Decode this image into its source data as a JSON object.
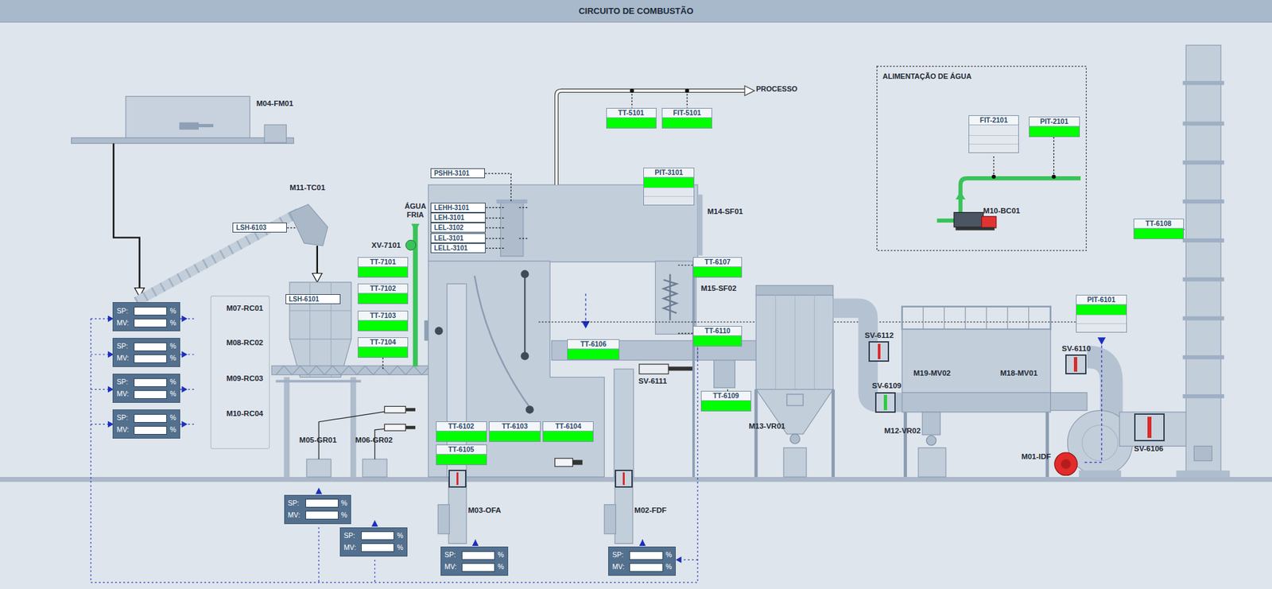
{
  "title": "CIRCUITO DE COMBUSTÃO",
  "equipment": [
    {
      "label": "M04-FM01"
    },
    {
      "label": "M11-TC01"
    },
    {
      "label": "M07-RC01"
    },
    {
      "label": "M08-RC02"
    },
    {
      "label": "M09-RC03"
    },
    {
      "label": "M10-RC04"
    },
    {
      "label": "M05-GR01"
    },
    {
      "label": "M06-GR02"
    },
    {
      "label": "M03-OFA"
    },
    {
      "label": "M02-FDF"
    },
    {
      "label": "M14-SF01"
    },
    {
      "label": "M15-SF02"
    },
    {
      "label": "M13-VR01"
    },
    {
      "label": "M19-MV02"
    },
    {
      "label": "M18-MV01"
    },
    {
      "label": "M12-VR02"
    },
    {
      "label": "M01-IDF"
    },
    {
      "label": "M10-BC01"
    },
    {
      "label": "SV-6111"
    }
  ],
  "notes": [
    {
      "text": "PROCESSO"
    },
    {
      "text": "ÁGUA FRIA"
    },
    {
      "text": "ALIMENTAÇÃO DE ÁGUA"
    }
  ],
  "valves": [
    {
      "label": "SV-6112",
      "color": "#d92b2b"
    },
    {
      "label": "SV-6109",
      "color": "#2ecc40"
    },
    {
      "label": "SV-6110",
      "color": "#d92b2b"
    },
    {
      "label": "SV-6106",
      "color": "#d92b2b"
    },
    {
      "label": "XV-7101",
      "color": "#39c35a"
    }
  ],
  "dampers": [
    {
      "color": "#d92b2b"
    },
    {
      "color": "#d92b2b"
    }
  ],
  "indicators": [
    {
      "tag": "TT-5101",
      "kind": "single",
      "color": "#00ff00"
    },
    {
      "tag": "FIT-5101",
      "kind": "single",
      "color": "#00ff00"
    },
    {
      "tag": "PIT-3101",
      "kind": "triple",
      "color": "#00ff00"
    },
    {
      "tag": "TT-7101",
      "kind": "single",
      "color": "#00ff00"
    },
    {
      "tag": "TT-7102",
      "kind": "single",
      "color": "#00ff00"
    },
    {
      "tag": "TT-7103",
      "kind": "single",
      "color": "#00ff00"
    },
    {
      "tag": "TT-7104",
      "kind": "single",
      "color": "#00ff00"
    },
    {
      "tag": "TT-6107",
      "kind": "single",
      "color": "#00ff00"
    },
    {
      "tag": "TT-6110",
      "kind": "single",
      "color": "#00ff00"
    },
    {
      "tag": "TT-6109",
      "kind": "single",
      "color": "#00ff00"
    },
    {
      "tag": "TT-6106",
      "kind": "single",
      "color": "#00ff00"
    },
    {
      "tag": "TT-6102",
      "kind": "single",
      "color": "#00ff00"
    },
    {
      "tag": "TT-6103",
      "kind": "single",
      "color": "#00ff00"
    },
    {
      "tag": "TT-6104",
      "kind": "single",
      "color": "#00ff00"
    },
    {
      "tag": "TT-6105",
      "kind": "single",
      "color": "#00ff00"
    },
    {
      "tag": "TT-6108",
      "kind": "single",
      "color": "#00ff00"
    },
    {
      "tag": "PIT-6101",
      "kind": "triple",
      "color": "#00ff00"
    },
    {
      "tag": "FIT-2101",
      "kind": "triple",
      "color": "#e3e8ee"
    },
    {
      "tag": "PIT-2101",
      "kind": "single",
      "color": "#00ff00"
    }
  ],
  "switches": [
    {
      "tag": "LSH-6103"
    },
    {
      "tag": "LSH-6101"
    },
    {
      "tag": "PSHH-3101"
    },
    {
      "tag": "LEHH-3101"
    },
    {
      "tag": "LEH-3101"
    },
    {
      "tag": "LEL-3102"
    },
    {
      "tag": "LEL-3101"
    },
    {
      "tag": "LELL-3101"
    }
  ],
  "controllers": [
    {
      "sp_label": "SP:",
      "sp_unit": "%",
      "mv_label": "MV:",
      "mv_unit": "%"
    },
    {
      "sp_label": "SP:",
      "sp_unit": "%",
      "mv_label": "MV:",
      "mv_unit": "%"
    },
    {
      "sp_label": "SP:",
      "sp_unit": "%",
      "mv_label": "MV:",
      "mv_unit": "%"
    },
    {
      "sp_label": "SP:",
      "sp_unit": "%",
      "mv_label": "MV:",
      "mv_unit": "%"
    },
    {
      "sp_label": "SP:",
      "sp_unit": "%",
      "mv_label": "MV:",
      "mv_unit": "%"
    },
    {
      "sp_label": "SP:",
      "sp_unit": "%",
      "mv_label": "MV:",
      "mv_unit": "%"
    },
    {
      "sp_label": "SP:",
      "sp_unit": "%",
      "mv_label": "MV:",
      "mv_unit": "%"
    },
    {
      "sp_label": "SP:",
      "sp_unit": "%",
      "mv_label": "MV:",
      "mv_unit": "%"
    }
  ]
}
